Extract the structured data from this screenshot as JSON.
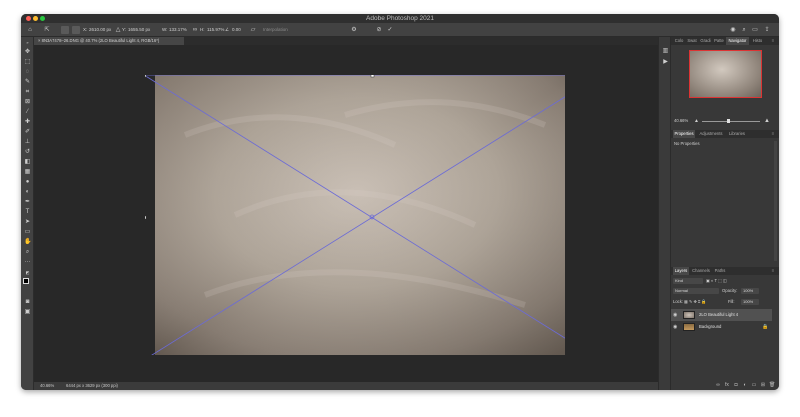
{
  "window": {
    "title": "Adobe Photoshop 2021"
  },
  "options_bar": {
    "x_label": "X:",
    "x_value": "2610.00 px",
    "y_label": "Y:",
    "y_value": "1655.50 px",
    "w_label": "W:",
    "w_value": "133.17%",
    "h_label": "H:",
    "h_value": "115.97%",
    "angle_label": "∠",
    "angle_value": "0.00",
    "interp_label": "Interpolation"
  },
  "document_tab": {
    "label": "8N3A7478–26.DNG @ 40.7% (2LO Beautiful Light 4, RGB/16*)"
  },
  "status_bar": {
    "zoom": "40.66%",
    "doc_size": "6444 px x 3629 px (300 ppi)"
  },
  "navigator": {
    "tabs": [
      "Color",
      "Swatches",
      "Gradients",
      "Patterns",
      "Navigator",
      "Histogram"
    ],
    "tab_labels": [
      "Colo",
      "Swat",
      "Gradi",
      "Patte",
      "Navigator",
      "Histo"
    ],
    "zoom": "40.66%"
  },
  "properties": {
    "tabs": [
      "Properties",
      "Adjustments",
      "Libraries"
    ],
    "empty_text": "No Properties"
  },
  "layers": {
    "tabs": [
      "Layers",
      "Channels",
      "Paths"
    ],
    "kind_filter": "Kind",
    "blend_mode": "Normal",
    "opacity_label": "Opacity:",
    "opacity_value": "100%",
    "lock_label": "Lock:",
    "fill_label": "Fill:",
    "fill_value": "100%",
    "items": [
      {
        "name": "2LO Beautiful Light 4",
        "selected": true
      },
      {
        "name": "Background",
        "selected": false
      }
    ]
  },
  "colors": {
    "canvas_bg": "#282828",
    "panel_bg": "#383838",
    "accent": "#6b6bd6",
    "selection": "#515151"
  }
}
